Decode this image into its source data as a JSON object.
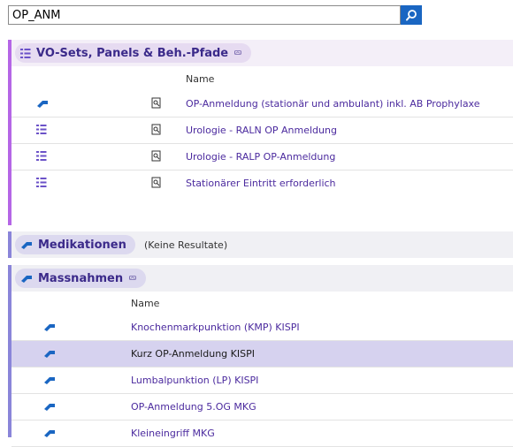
{
  "search": {
    "value": "OP_ANM"
  },
  "colors": {
    "accent_purple": "#b566e6",
    "accent_blue": "#8a85d9",
    "link": "#4b2a9e",
    "selected_row": "#d6d2ef"
  },
  "sections": {
    "vo_sets": {
      "title": "VO-Sets, Panels & Beh.-Pfade",
      "column_name": "Name",
      "rows": [
        {
          "icon": "pill-icon",
          "name": "OP-Anmeldung (stationär und ambulant) inkl. AB Prophylaxe"
        },
        {
          "icon": "list-icon",
          "name": "Urologie - RALN OP Anmeldung"
        },
        {
          "icon": "list-icon",
          "name": "Urologie - RALP OP-Anmeldung"
        },
        {
          "icon": "list-icon",
          "name": "Stationärer Eintritt erforderlich"
        }
      ]
    },
    "medikationen": {
      "title": "Medikationen",
      "status": "(Keine Resultate)"
    },
    "massnahmen": {
      "title": "Massnahmen",
      "column_name": "Name",
      "rows": [
        {
          "icon": "pill-icon",
          "name": "Knochenmarkpunktion (KMP) KISPI"
        },
        {
          "icon": "pill-icon",
          "name": "Kurz OP-Anmeldung KISPI",
          "selected": true
        },
        {
          "icon": "pill-icon",
          "name": "Lumbalpunktion (LP) KISPI"
        },
        {
          "icon": "pill-icon",
          "name": "OP-Anmeldung 5.OG MKG"
        },
        {
          "icon": "pill-icon",
          "name": "Kleineingriff MKG"
        }
      ]
    }
  }
}
